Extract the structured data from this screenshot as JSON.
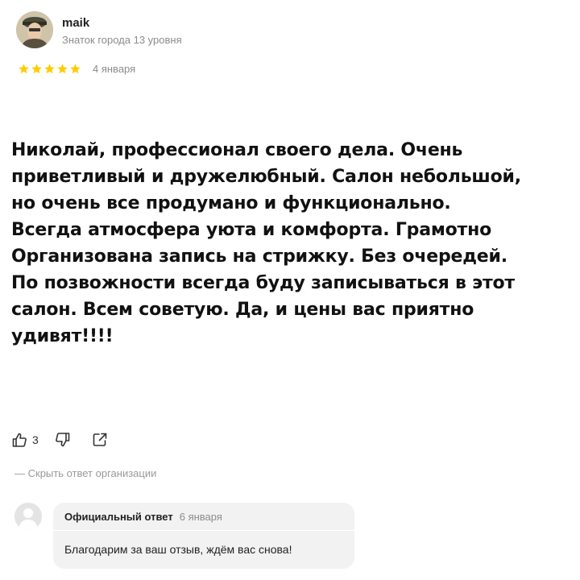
{
  "author": {
    "name": "maik",
    "level": "Знаток города 13 уровня"
  },
  "review": {
    "rating": 5,
    "rating_max": 5,
    "date": "4 января",
    "text": "Николай, профессионал своего дела. Очень\nприветливый и дружелюбный. Салон небольшой,\nно очень все продумано и функционально.\nВсегда атмосфера уюта и комфорта. Грамотно\nОрганизована запись на стрижку. Без очередей.\nПо позвожности всегда буду записываться в этот\nсалон. Всем советую. Да, и цены вас приятно\nудивят!!!!"
  },
  "actions": {
    "like_count": "3",
    "icons": [
      "thumbs-up-icon",
      "thumbs-down-icon",
      "share-icon"
    ]
  },
  "hide_reply_label": "— Скрыть ответ организации",
  "org_reply": {
    "label": "Официальный ответ",
    "date": "6 января",
    "text": "Благодарим за ваш отзыв, ждём вас снова!"
  },
  "colors": {
    "star": "#fc3f1d",
    "star_fill": "#ffcc00",
    "muted_text": "#8c8c8c",
    "bubble_bg": "#f2f2f2"
  }
}
